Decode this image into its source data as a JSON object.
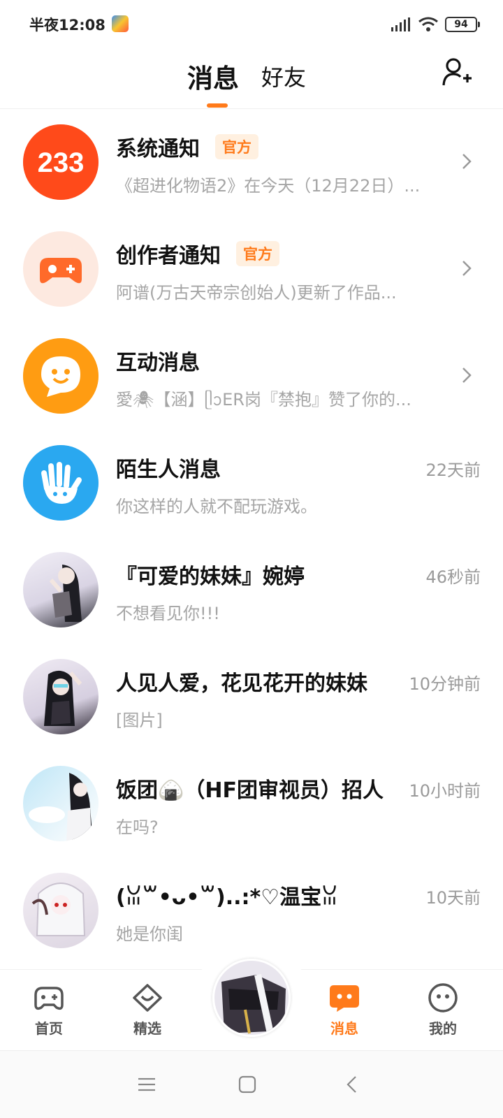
{
  "status_bar": {
    "time": "半夜12:08",
    "battery": "94"
  },
  "header": {
    "tab_active": "消息",
    "tab_other": "好友"
  },
  "messages": [
    {
      "title": "系统通知",
      "badge": "官方",
      "subtitle": "《超进化物语2》在今天（12月22日）...",
      "time": ""
    },
    {
      "title": "创作者通知",
      "badge": "官方",
      "subtitle": "阿谱(万古天帝宗创始人)更新了作品...",
      "time": ""
    },
    {
      "title": "互动消息",
      "badge": "",
      "subtitle": "愛🕷【涵】ᥫᩣER岗『禁抱』赞了你的...",
      "time": ""
    },
    {
      "title": "陌生人消息",
      "badge": "",
      "subtitle": "你这样的人就不配玩游戏。",
      "time": "22天前"
    },
    {
      "title": "『可爱的妹妹』婉婷",
      "badge": "",
      "subtitle": "不想看见你!!!",
      "time": "46秒前"
    },
    {
      "title": "人见人爱，花见花开的妹妹",
      "badge": "",
      "subtitle": "[图片]",
      "time": "10分钟前"
    },
    {
      "title": "饭团🍙（HF团审视员）招人",
      "badge": "",
      "subtitle": "在吗?",
      "time": "10小时前"
    },
    {
      "title": "(ꈍ꒳•ᴗ•꒳)..:*♡温宝ꈍ",
      "badge": "",
      "subtitle": "她是你闺",
      "time": "10天前"
    }
  ],
  "avatar_text": {
    "system": "233"
  },
  "bottom_nav": [
    {
      "label": "首页",
      "icon": "gamepad-icon"
    },
    {
      "label": "精选",
      "icon": "heart-box-icon"
    },
    {
      "label": "消息",
      "icon": "message-icon"
    },
    {
      "label": "我的",
      "icon": "face-icon"
    }
  ],
  "colors": {
    "accent": "#ff7a1a",
    "sub_text": "#a5a5a5",
    "blue": "#2aa8f0"
  }
}
